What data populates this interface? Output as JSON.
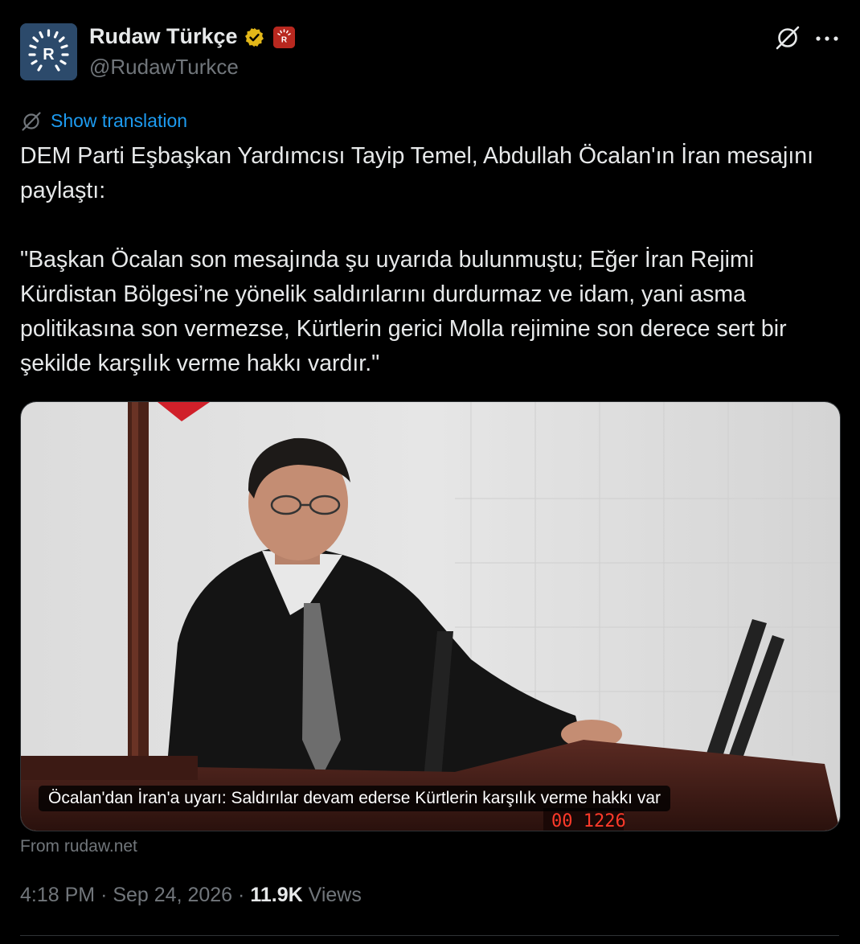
{
  "author": {
    "display_name": "Rudaw Türkçe",
    "handle": "@RudawTurkce",
    "avatar_letter": "R",
    "avatar_icon": "rudaw-logo-icon",
    "verified_badge_icon": "gold-verified-icon",
    "affiliate_badge_icon": "rudaw-affiliate-icon",
    "affiliate_letter": "R"
  },
  "actions": {
    "grok_icon": "grok-icon",
    "more_icon": "more-options-icon"
  },
  "translation": {
    "icon": "globe-translate-icon",
    "label": "Show translation"
  },
  "tweet": {
    "paragraphs": [
      "DEM Parti Eşbaşkan Yardımcısı Tayip Temel, Abdullah Öcalan'ın İran mesajını paylaştı:",
      "\"Başkan Öcalan son mesajında şu uyarıda bulunmuştu; Eğer İran Rejimi Kürdistan Bölgesi’ne yönelik saldırılarını durdurmaz ve idam, yani asma politikasına son vermezse, Kürtlerin gerici Molla rejimine son derece sert bir şekilde karşılık verme hakkı vardır.\""
    ]
  },
  "card": {
    "headline": "Öcalan'dan İran'a uyarı: Saldırılar devam ederse Kürtlerin karşılık verme hakkı var",
    "source": "From rudaw.net",
    "timer_digits": "00 1226"
  },
  "meta": {
    "time": "4:18 PM",
    "separator": "·",
    "date": "Sep 24, 2026",
    "views_count": "11.9K",
    "views_label": "Views"
  },
  "colors": {
    "background": "#000000",
    "text": "#e7e9ea",
    "secondary": "#71767b",
    "link": "#1d9bf0",
    "verified_gold": "#e2b719",
    "affiliate_red": "#b8281f",
    "avatar_bg": "#2c4a6b"
  }
}
